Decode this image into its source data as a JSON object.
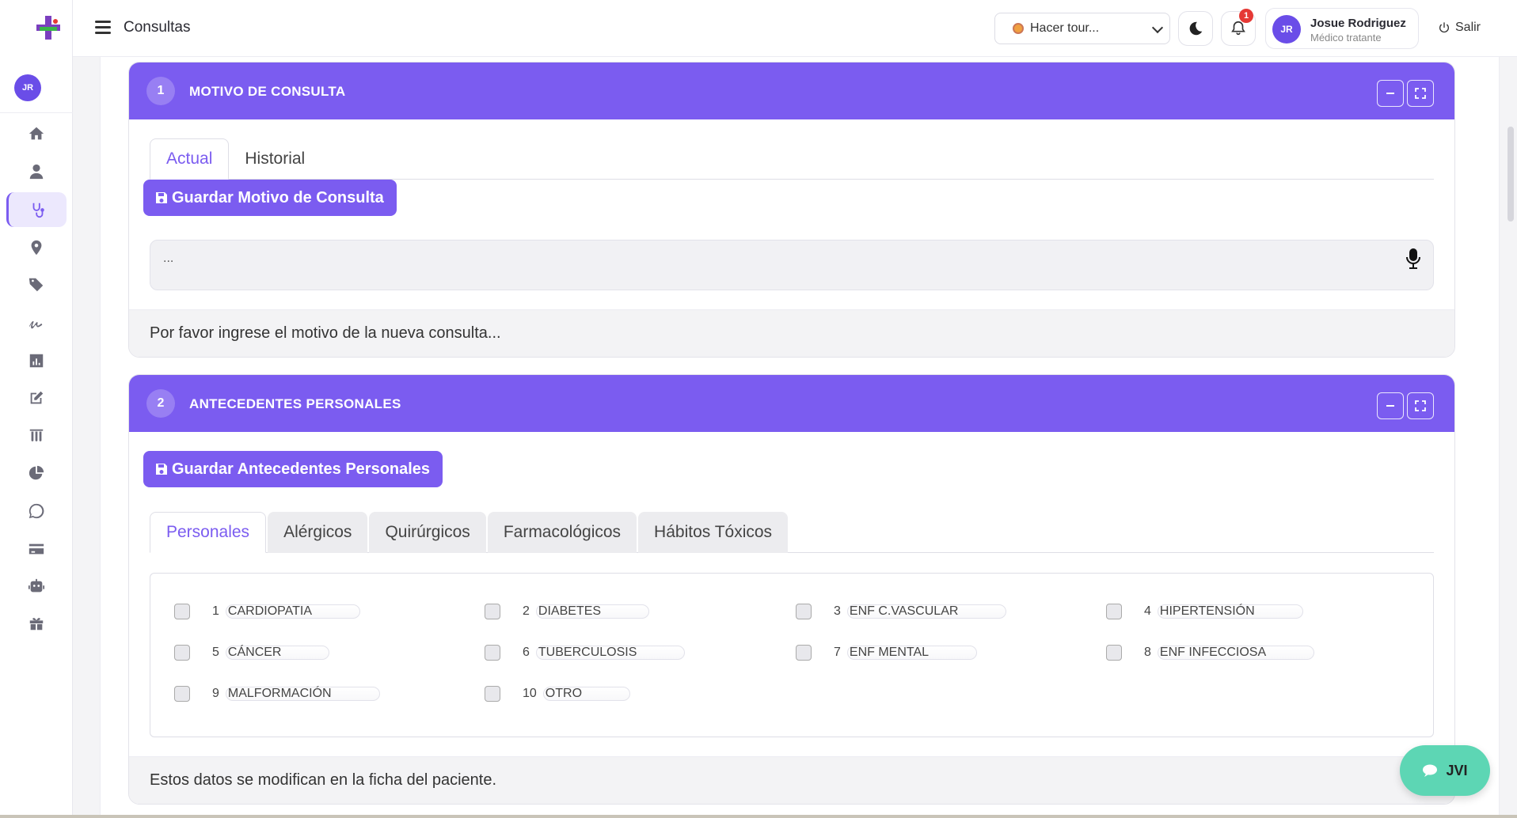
{
  "topbar": {
    "title": "Consultas",
    "tour_label": "Hacer tour...",
    "notification_count": "1",
    "user_initials": "JR",
    "user_name": "Josue Rodriguez",
    "user_role": "Médico tratante",
    "logout_label": "Salir"
  },
  "sidebar": {
    "avatar_initials": "JR",
    "items": [
      "home-icon",
      "user-icon",
      "stethoscope-icon",
      "map-marker-icon",
      "tags-icon",
      "signature-icon",
      "bar-chart-icon",
      "edit-icon",
      "lab-icon",
      "pie-chart-icon",
      "whatsapp-icon",
      "credit-card-icon",
      "robot-icon",
      "gift-icon"
    ],
    "active_item": "stethoscope-icon"
  },
  "colors": {
    "accent": "#7b5cf0",
    "fab": "#5dd6b4",
    "badge": "#e53935"
  },
  "motivo": {
    "number": "1",
    "title": "MOTIVO DE CONSULTA",
    "tabs": [
      "Actual",
      "Historial"
    ],
    "active_tab": "Actual",
    "save_label": "Guardar Motivo de Consulta",
    "textarea_value": "...",
    "footer": "Por favor ingrese el motivo de la nueva consulta..."
  },
  "antecedentes": {
    "number": "2",
    "title": "ANTECEDENTES PERSONALES",
    "save_label": "Guardar Antecedentes Personales",
    "tabs": [
      "Personales",
      "Alérgicos",
      "Quirúrgicos",
      "Farmacológicos",
      "Hábitos Tóxicos"
    ],
    "active_tab": "Personales",
    "items": [
      {
        "num": "1",
        "label": "CARDIOPATIA",
        "checked": false
      },
      {
        "num": "2",
        "label": "DIABETES",
        "checked": false
      },
      {
        "num": "3",
        "label": "ENF C.VASCULAR",
        "checked": false
      },
      {
        "num": "4",
        "label": "HIPERTENSIÓN",
        "checked": false
      },
      {
        "num": "5",
        "label": "CÁNCER",
        "checked": false
      },
      {
        "num": "6",
        "label": "TUBERCULOSIS",
        "checked": false
      },
      {
        "num": "7",
        "label": "ENF MENTAL",
        "checked": false
      },
      {
        "num": "8",
        "label": "ENF INFECCIOSA",
        "checked": false
      },
      {
        "num": "9",
        "label": "MALFORMACIÓN",
        "checked": false
      },
      {
        "num": "10",
        "label": "OTRO",
        "checked": false
      }
    ],
    "footer": "Estos datos se modifican en la ficha del paciente."
  },
  "chat": {
    "label": "JVI"
  }
}
